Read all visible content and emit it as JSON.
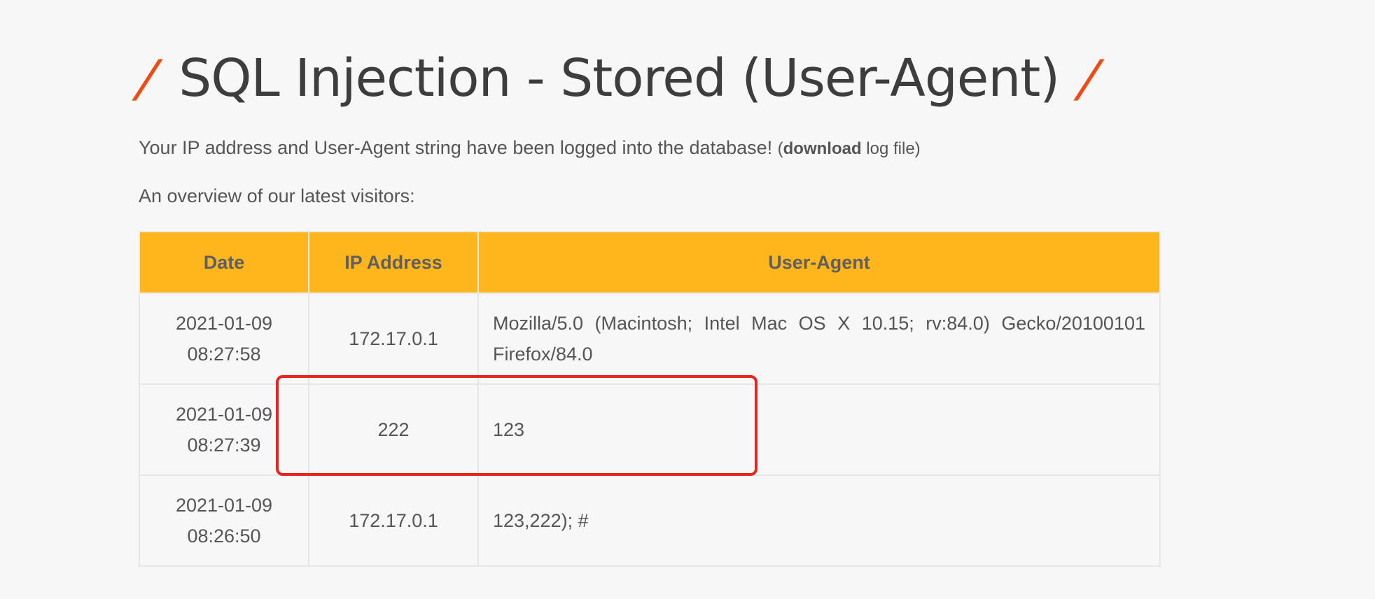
{
  "page": {
    "title": "SQL Injection - Stored (User-Agent)",
    "title_slash": "/"
  },
  "intro": {
    "text": "Your IP address and User-Agent string have been logged into the database! ",
    "paren_open": "(",
    "download_link": "download",
    "link_suffix": " log file",
    "paren_close": ")"
  },
  "overview": {
    "text": "An overview of our latest visitors:"
  },
  "table": {
    "headers": [
      "Date",
      "IP Address",
      "User-Agent"
    ],
    "rows": [
      {
        "date_day": "2021-01-09",
        "date_time": "08:27:58",
        "ip": "172.17.0.1",
        "user_agent": "Mozilla/5.0 (Macintosh; Intel Mac OS X 10.15; rv:84.0) Gecko/20100101 Firefox/84.0"
      },
      {
        "date_day": "2021-01-09",
        "date_time": "08:27:39",
        "ip": "222",
        "user_agent": "123"
      },
      {
        "date_day": "2021-01-09",
        "date_time": "08:26:50",
        "ip": "172.17.0.1",
        "user_agent": "123,222); #"
      }
    ]
  },
  "colors": {
    "header_bg": "#ffb51c",
    "accent_slash": "#ee4b15",
    "annotation_box": "#e8241e",
    "page_bg": "#f7f7f7"
  }
}
